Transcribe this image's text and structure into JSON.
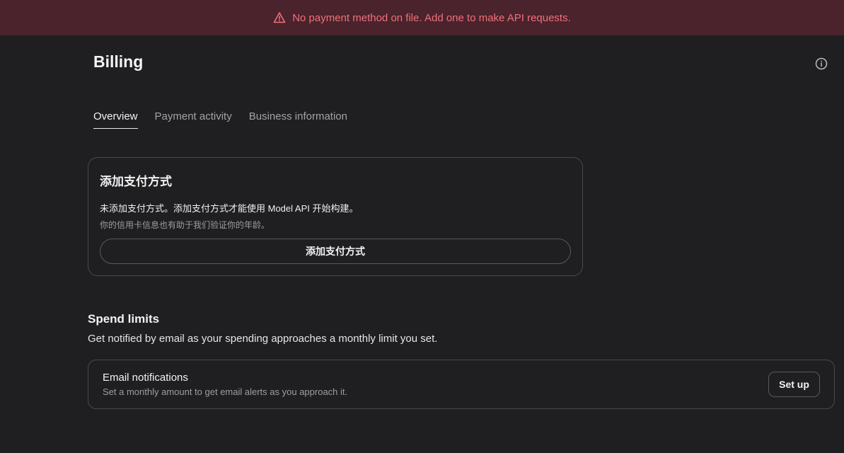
{
  "banner": {
    "icon": "warning-triangle-icon",
    "text": "No payment method on file. Add one to make API requests.",
    "color": "#f0707c",
    "background": "#4a232c"
  },
  "header": {
    "title": "Billing",
    "info_icon": "info-circle-icon"
  },
  "tabs": [
    {
      "label": "Overview",
      "active": true
    },
    {
      "label": "Payment activity",
      "active": false
    },
    {
      "label": "Business information",
      "active": false
    }
  ],
  "payment_card": {
    "title": "添加支付方式",
    "description": "未添加支付方式。添加支付方式才能使用 Model API 开始构建。",
    "note": "你的信用卡信息也有助于我们验证你的年龄。",
    "button_label": "添加支付方式"
  },
  "spend_limits": {
    "title": "Spend limits",
    "description": "Get notified by email as your spending approaches a monthly limit you set.",
    "email_card": {
      "title": "Email notifications",
      "description": "Set a monthly amount to get email alerts as you approach it.",
      "button_label": "Set up"
    }
  }
}
